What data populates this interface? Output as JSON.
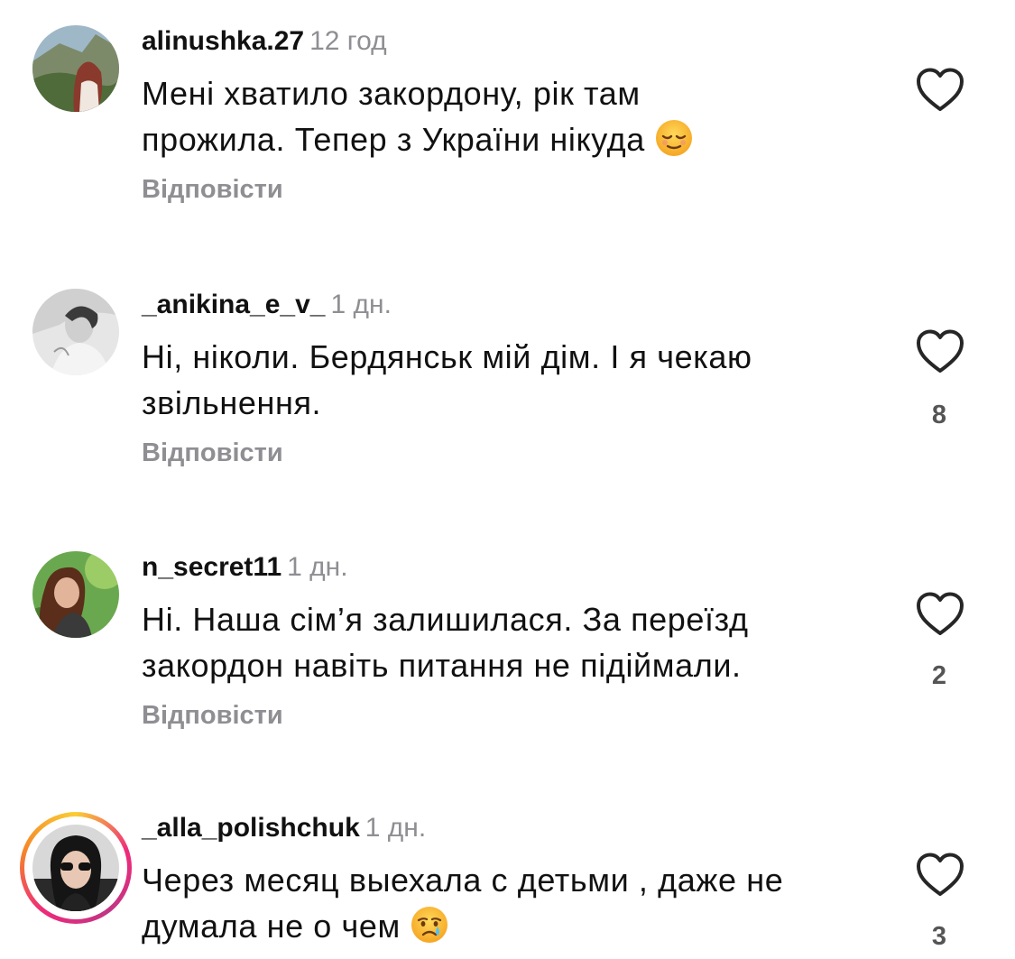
{
  "comments": [
    {
      "username": "alinushka.27",
      "time": "12 год",
      "text_lines": [
        "Мені хватило закордону, рік там",
        "прожила. Тепер з України нікуда"
      ],
      "emoji": "relieved-face-icon",
      "reply_label": "Відповісти",
      "likes": ""
    },
    {
      "username": "_anikina_e_v_",
      "time": "1 дн.",
      "text_lines": [
        "Ні, ніколи. Бердянськ мій дім. І я чекаю",
        "звільнення."
      ],
      "emoji": "",
      "reply_label": "Відповісти",
      "likes": "8"
    },
    {
      "username": "n_secret11",
      "time": "1 дн.",
      "text_lines": [
        "Ні. Наша сім’я залишилася. За переїзд",
        "закордон  навіть питання не підіймали."
      ],
      "emoji": "",
      "reply_label": "Відповісти",
      "likes": "2"
    },
    {
      "username": "_alla_polishchuk",
      "time": "1 дн.",
      "text_lines": [
        "Через месяц выехала с детьми , даже не",
        "думала не о чем"
      ],
      "emoji": "crying-face-icon",
      "reply_label": "",
      "likes": "3"
    }
  ],
  "colors": {
    "secondary_text": "#8e8e93",
    "primary_text": "#111111",
    "heart_outline": "#262626",
    "story_ring": [
      "#f9ce34",
      "#ee2a7b",
      "#c13584"
    ]
  }
}
